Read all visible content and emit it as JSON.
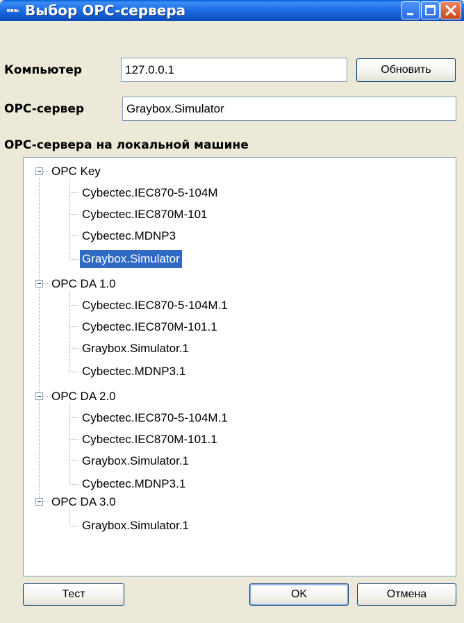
{
  "window": {
    "title": "Выбор OPC-сервера",
    "title_bar_color": "#0a49b8",
    "controls": [
      "minimize-icon",
      "maximize-icon",
      "close-icon"
    ]
  },
  "computer": {
    "label": "Компьютер",
    "value": "127.0.0.1",
    "refresh_label": "Обновить"
  },
  "server": {
    "label": "OPC-сервер",
    "value": "Graybox.Simulator"
  },
  "tree": {
    "heading": "OPC-сервера на локальной машине",
    "selection_color": "#316ac5",
    "groups": [
      {
        "label": "OPC Key",
        "expanded": true,
        "items": [
          "Cybectec.IEC870-5-104M",
          "Cybectec.IEC870M-101",
          "Cybectec.MDNP3",
          "Graybox.Simulator"
        ],
        "selected_index": 3
      },
      {
        "label": "OPC DA 1.0",
        "expanded": true,
        "items": [
          "Cybectec.IEC870-5-104M.1",
          "Cybectec.IEC870M-101.1",
          "Graybox.Simulator.1",
          "Cybectec.MDNP3.1"
        ]
      },
      {
        "label": "OPC DA 2.0",
        "expanded": true,
        "items": [
          "Cybectec.IEC870-5-104M.1",
          "Cybectec.IEC870M-101.1",
          "Graybox.Simulator.1",
          "Cybectec.MDNP3.1"
        ]
      },
      {
        "label": "OPC DA 3.0",
        "expanded": true,
        "items": [
          "Graybox.Simulator.1"
        ]
      }
    ]
  },
  "buttons": {
    "test": "Тест",
    "ok": "OK",
    "cancel": "Отмена"
  }
}
